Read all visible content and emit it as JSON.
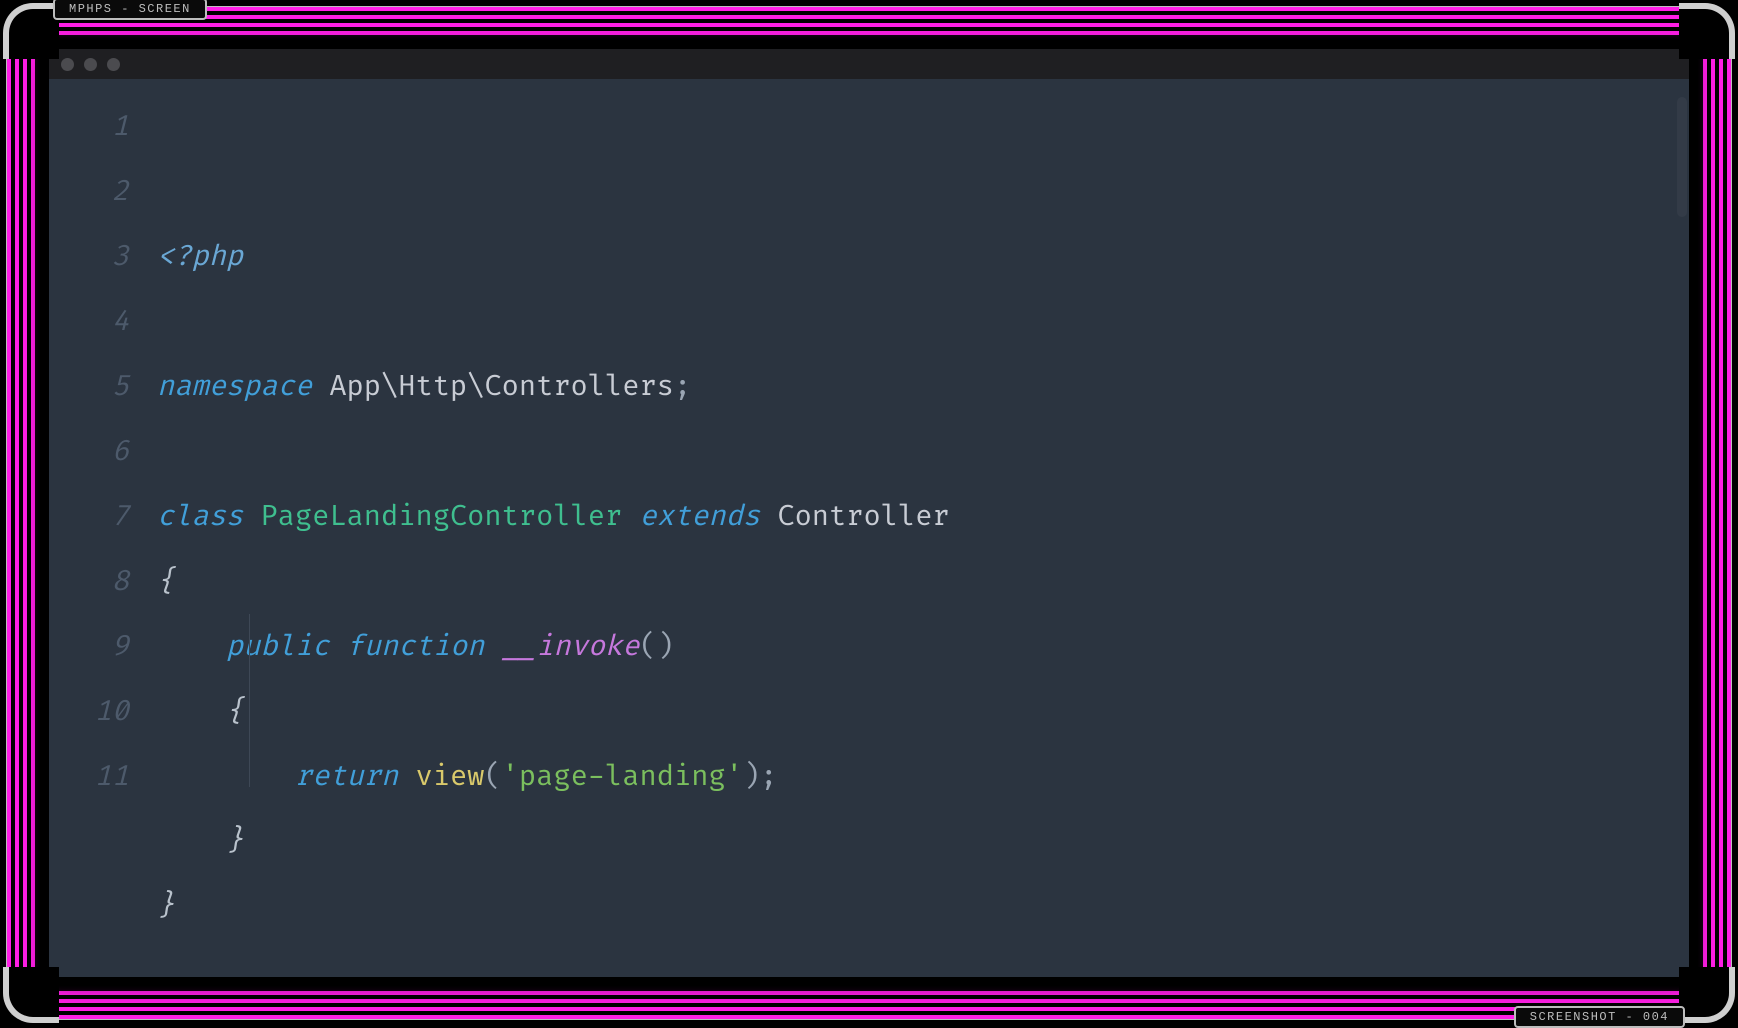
{
  "frame": {
    "top_label": "MPHPS - SCREEN",
    "bottom_label": "SCREENSHOT - 004"
  },
  "editor": {
    "mac_buttons": [
      "close",
      "min",
      "max"
    ],
    "line_numbers": [
      "1",
      "2",
      "3",
      "4",
      "5",
      "6",
      "7",
      "8",
      "9",
      "10",
      "11"
    ],
    "tokens": {
      "php_open": "<?php",
      "kw_namespace": "namespace",
      "ns_path": "App\\Http\\Controllers",
      "semi": ";",
      "kw_class": "class",
      "class_name": "PageLandingController",
      "kw_extends": "extends",
      "base_class": "Controller",
      "brace_open": "{",
      "kw_public": "public",
      "kw_function": "function",
      "method_name": "__invoke",
      "parens": "()",
      "kw_return": "return",
      "fn_view": "view",
      "str_arg": "'page-landing'",
      "paren_close_semi": ");",
      "brace_close": "}"
    }
  }
}
